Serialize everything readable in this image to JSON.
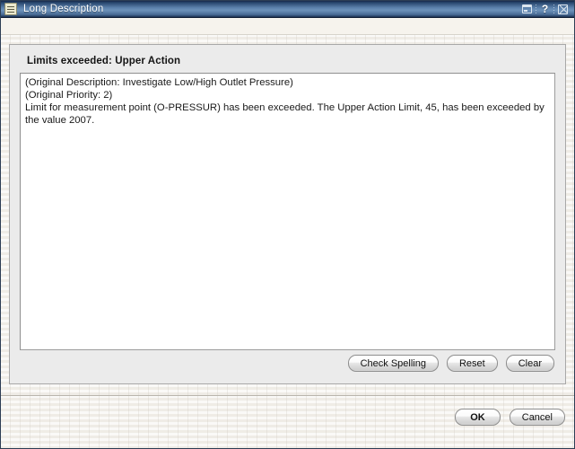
{
  "window": {
    "title": "Long Description",
    "icon": "document-lines-icon",
    "controls": [
      {
        "name": "restore-button",
        "label": ""
      },
      {
        "name": "help-button",
        "label": "?"
      },
      {
        "name": "close-button",
        "label": ""
      }
    ]
  },
  "panel": {
    "title": "Limits exceeded: Upper Action",
    "description_lines": [
      "(Original Description: Investigate Low/High Outlet Pressure)",
      "(Original Priority: 2)",
      "Limit for measurement point (O-PRESSUR) has been exceeded. The Upper Action Limit, 45, has been exceeded by the value 2007."
    ],
    "buttons": {
      "check_spelling": "Check Spelling",
      "reset": "Reset",
      "clear": "Clear"
    }
  },
  "footer": {
    "ok": "OK",
    "cancel": "Cancel"
  },
  "colors": {
    "titlebar_dark": "#16284a",
    "titlebar_light": "#6d92ba",
    "panel_bg": "#ebebeb",
    "page_bg": "#f4f2ee",
    "text": "#1a1a1a"
  }
}
